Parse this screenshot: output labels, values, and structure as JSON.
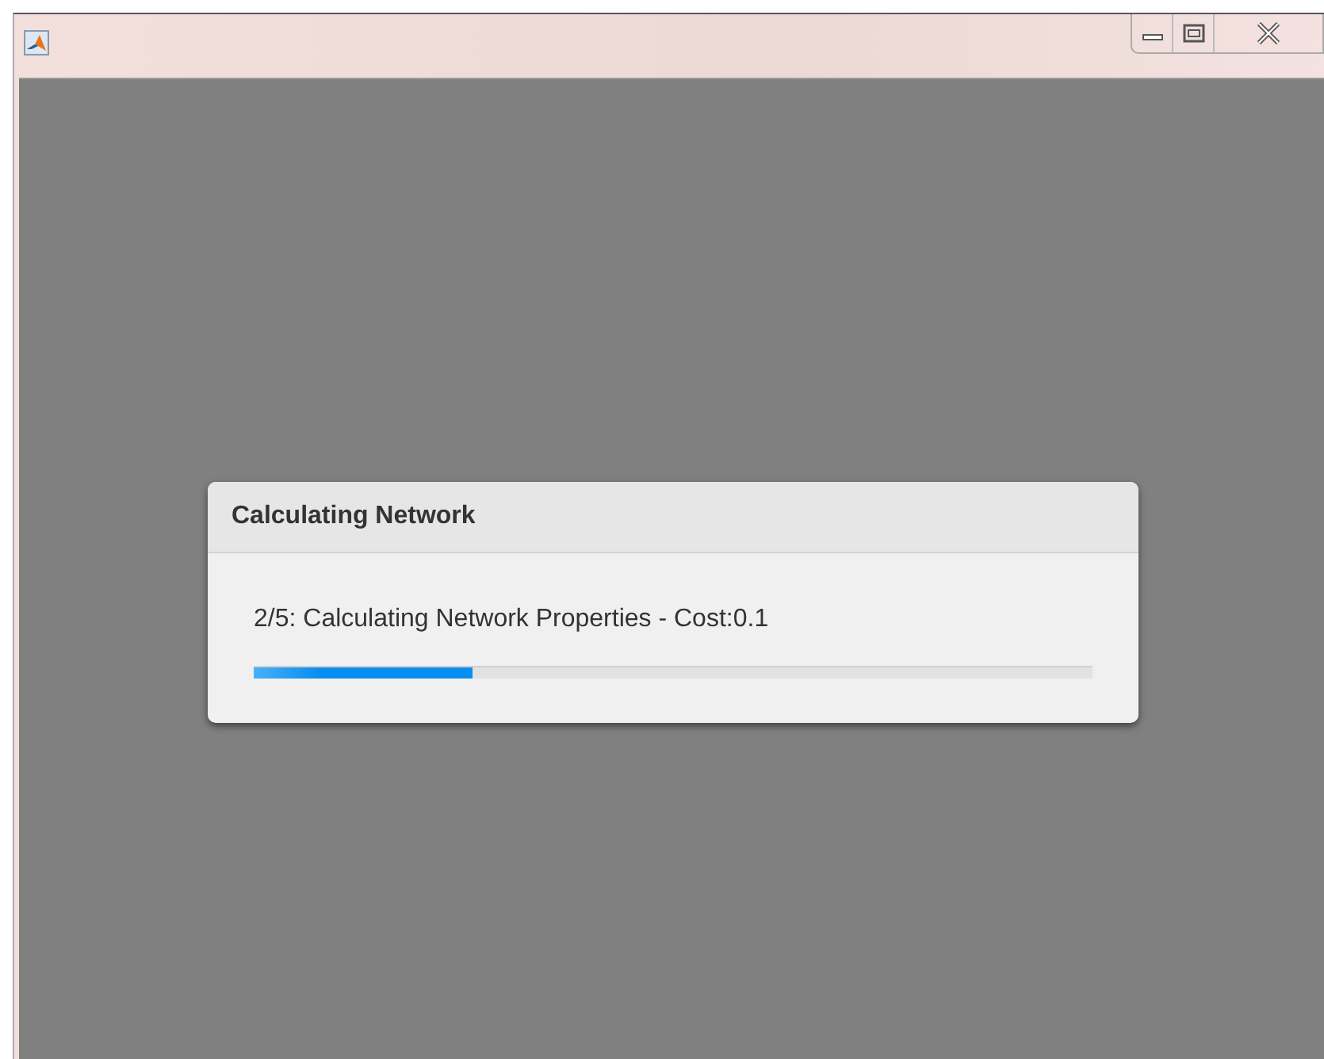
{
  "dialog": {
    "title": "Calculating Network",
    "message": "2/5: Calculating Network Properties - Cost:0.1",
    "progress": {
      "level": 0.26
    }
  }
}
